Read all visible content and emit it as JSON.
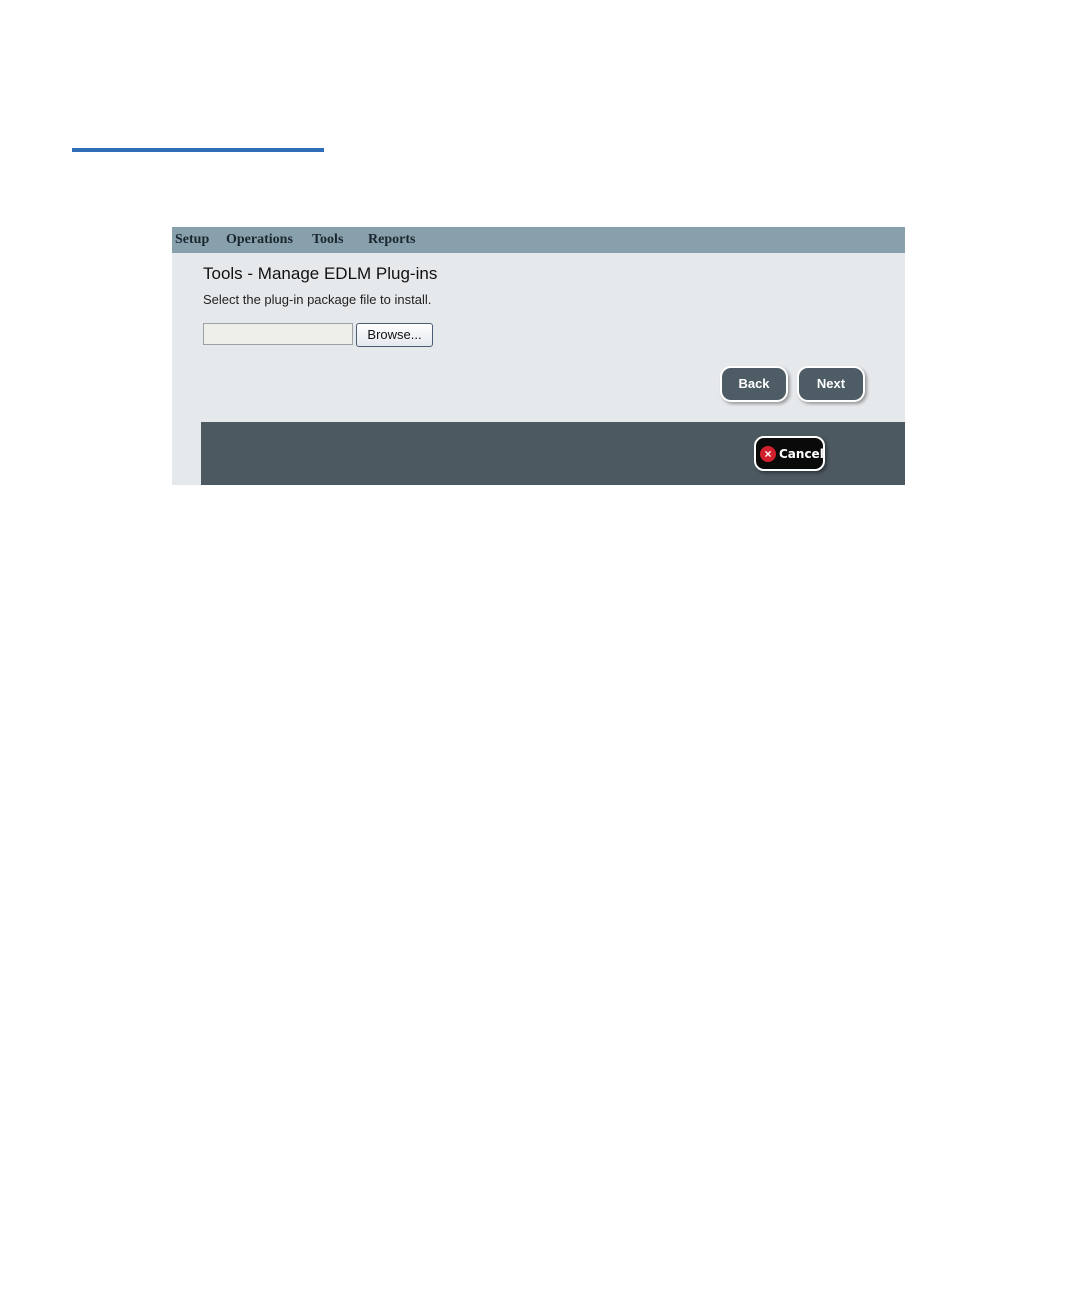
{
  "menubar": {
    "items": [
      {
        "label": "Setup"
      },
      {
        "label": "Operations"
      },
      {
        "label": "Tools"
      },
      {
        "label": "Reports"
      }
    ]
  },
  "page": {
    "title": "Tools - Manage EDLM Plug-ins",
    "instruction": "Select the plug-in package file to install."
  },
  "file_picker": {
    "value": "",
    "browse_label": "Browse..."
  },
  "navigation": {
    "back_label": "Back",
    "next_label": "Next"
  },
  "footer": {
    "cancel_label": "Cancel",
    "cancel_icon": "x-icon"
  },
  "colors": {
    "accent_rule": "#2f6db8",
    "menubar": "#87a0ab",
    "footer": "#4c5961",
    "cancel_icon": "#d3202f"
  }
}
